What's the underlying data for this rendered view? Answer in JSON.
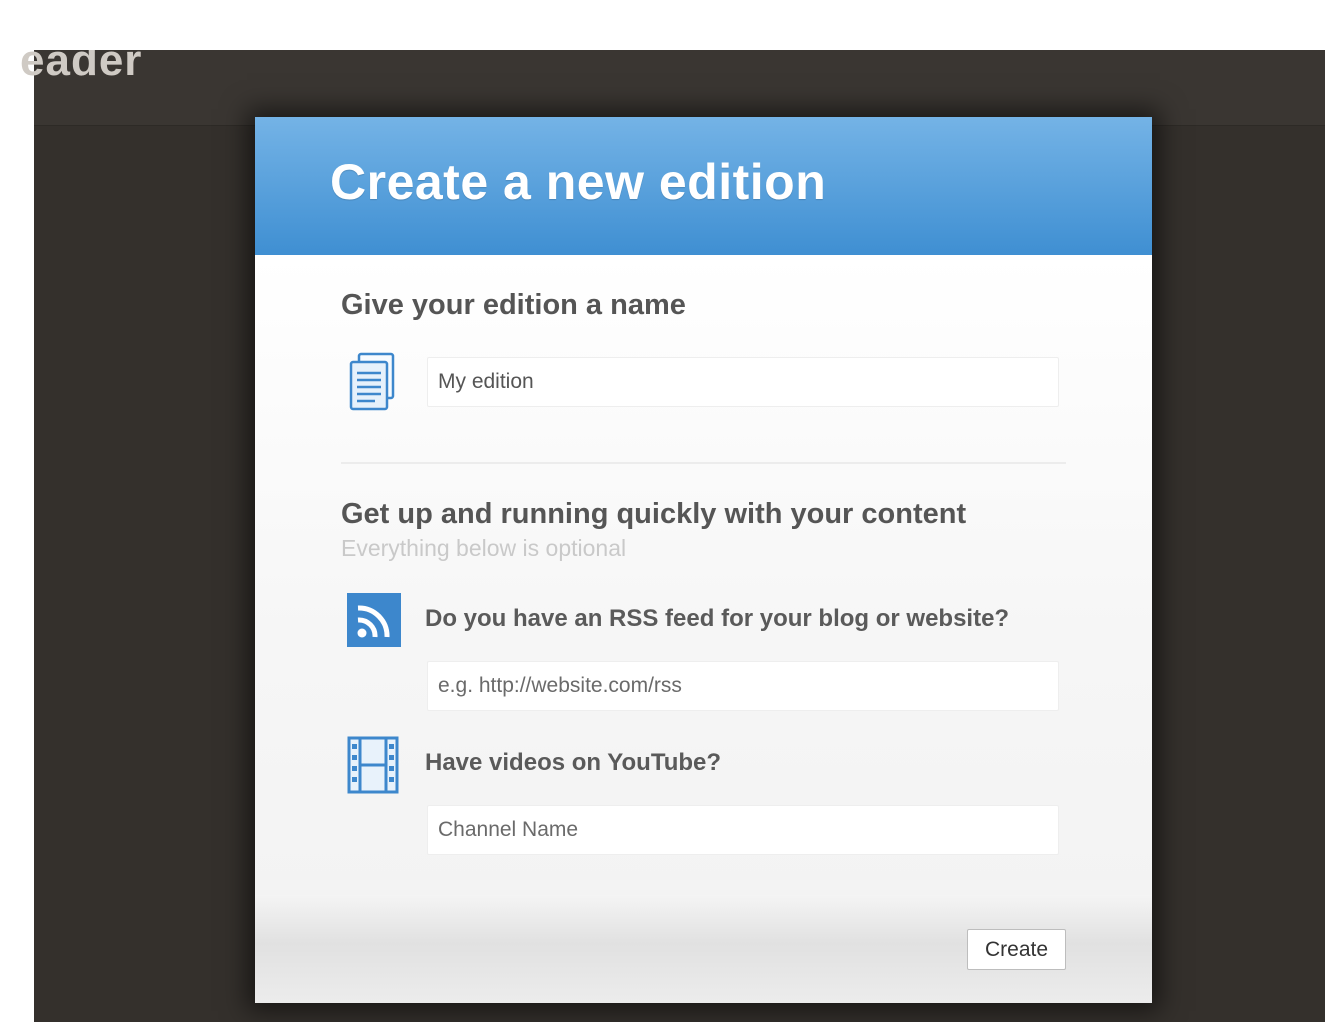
{
  "background": {
    "title_fragment": "eader"
  },
  "dialog": {
    "title": "Create a new edition",
    "name_section": {
      "heading": "Give your edition a name",
      "input_value": "My edition",
      "icon": "document-icon"
    },
    "content_section": {
      "heading": "Get up and running quickly with your content",
      "subheading": "Everything below is optional",
      "rss": {
        "icon": "rss-icon",
        "question": "Do you have an RSS feed for your blog or website?",
        "placeholder": "e.g. http://website.com/rss"
      },
      "youtube": {
        "icon": "film-icon",
        "question": "Have videos on YouTube?",
        "placeholder": "Channel Name"
      }
    },
    "create_label": "Create"
  },
  "colors": {
    "header_top": "#74b3e6",
    "header_bottom": "#3f8fd2",
    "backdrop": "#34302c",
    "icon_blue": "#3d87cc"
  }
}
